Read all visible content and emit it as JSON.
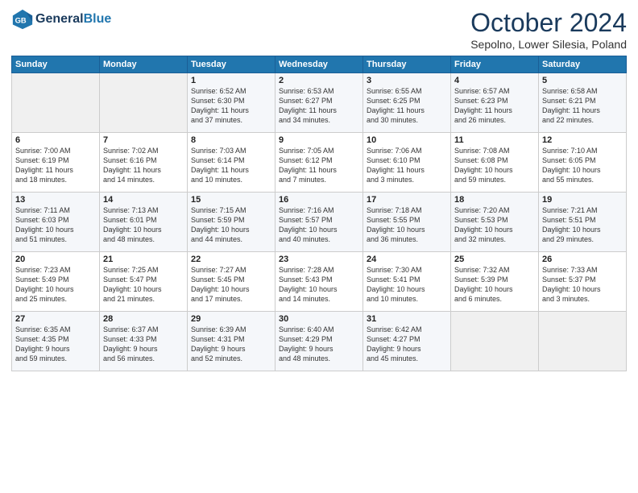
{
  "logo": {
    "line1": "General",
    "line2": "Blue"
  },
  "title": "October 2024",
  "subtitle": "Sepolno, Lower Silesia, Poland",
  "headers": [
    "Sunday",
    "Monday",
    "Tuesday",
    "Wednesday",
    "Thursday",
    "Friday",
    "Saturday"
  ],
  "weeks": [
    [
      {
        "day": "",
        "info": ""
      },
      {
        "day": "",
        "info": ""
      },
      {
        "day": "1",
        "info": "Sunrise: 6:52 AM\nSunset: 6:30 PM\nDaylight: 11 hours\nand 37 minutes."
      },
      {
        "day": "2",
        "info": "Sunrise: 6:53 AM\nSunset: 6:27 PM\nDaylight: 11 hours\nand 34 minutes."
      },
      {
        "day": "3",
        "info": "Sunrise: 6:55 AM\nSunset: 6:25 PM\nDaylight: 11 hours\nand 30 minutes."
      },
      {
        "day": "4",
        "info": "Sunrise: 6:57 AM\nSunset: 6:23 PM\nDaylight: 11 hours\nand 26 minutes."
      },
      {
        "day": "5",
        "info": "Sunrise: 6:58 AM\nSunset: 6:21 PM\nDaylight: 11 hours\nand 22 minutes."
      }
    ],
    [
      {
        "day": "6",
        "info": "Sunrise: 7:00 AM\nSunset: 6:19 PM\nDaylight: 11 hours\nand 18 minutes."
      },
      {
        "day": "7",
        "info": "Sunrise: 7:02 AM\nSunset: 6:16 PM\nDaylight: 11 hours\nand 14 minutes."
      },
      {
        "day": "8",
        "info": "Sunrise: 7:03 AM\nSunset: 6:14 PM\nDaylight: 11 hours\nand 10 minutes."
      },
      {
        "day": "9",
        "info": "Sunrise: 7:05 AM\nSunset: 6:12 PM\nDaylight: 11 hours\nand 7 minutes."
      },
      {
        "day": "10",
        "info": "Sunrise: 7:06 AM\nSunset: 6:10 PM\nDaylight: 11 hours\nand 3 minutes."
      },
      {
        "day": "11",
        "info": "Sunrise: 7:08 AM\nSunset: 6:08 PM\nDaylight: 10 hours\nand 59 minutes."
      },
      {
        "day": "12",
        "info": "Sunrise: 7:10 AM\nSunset: 6:05 PM\nDaylight: 10 hours\nand 55 minutes."
      }
    ],
    [
      {
        "day": "13",
        "info": "Sunrise: 7:11 AM\nSunset: 6:03 PM\nDaylight: 10 hours\nand 51 minutes."
      },
      {
        "day": "14",
        "info": "Sunrise: 7:13 AM\nSunset: 6:01 PM\nDaylight: 10 hours\nand 48 minutes."
      },
      {
        "day": "15",
        "info": "Sunrise: 7:15 AM\nSunset: 5:59 PM\nDaylight: 10 hours\nand 44 minutes."
      },
      {
        "day": "16",
        "info": "Sunrise: 7:16 AM\nSunset: 5:57 PM\nDaylight: 10 hours\nand 40 minutes."
      },
      {
        "day": "17",
        "info": "Sunrise: 7:18 AM\nSunset: 5:55 PM\nDaylight: 10 hours\nand 36 minutes."
      },
      {
        "day": "18",
        "info": "Sunrise: 7:20 AM\nSunset: 5:53 PM\nDaylight: 10 hours\nand 32 minutes."
      },
      {
        "day": "19",
        "info": "Sunrise: 7:21 AM\nSunset: 5:51 PM\nDaylight: 10 hours\nand 29 minutes."
      }
    ],
    [
      {
        "day": "20",
        "info": "Sunrise: 7:23 AM\nSunset: 5:49 PM\nDaylight: 10 hours\nand 25 minutes."
      },
      {
        "day": "21",
        "info": "Sunrise: 7:25 AM\nSunset: 5:47 PM\nDaylight: 10 hours\nand 21 minutes."
      },
      {
        "day": "22",
        "info": "Sunrise: 7:27 AM\nSunset: 5:45 PM\nDaylight: 10 hours\nand 17 minutes."
      },
      {
        "day": "23",
        "info": "Sunrise: 7:28 AM\nSunset: 5:43 PM\nDaylight: 10 hours\nand 14 minutes."
      },
      {
        "day": "24",
        "info": "Sunrise: 7:30 AM\nSunset: 5:41 PM\nDaylight: 10 hours\nand 10 minutes."
      },
      {
        "day": "25",
        "info": "Sunrise: 7:32 AM\nSunset: 5:39 PM\nDaylight: 10 hours\nand 6 minutes."
      },
      {
        "day": "26",
        "info": "Sunrise: 7:33 AM\nSunset: 5:37 PM\nDaylight: 10 hours\nand 3 minutes."
      }
    ],
    [
      {
        "day": "27",
        "info": "Sunrise: 6:35 AM\nSunset: 4:35 PM\nDaylight: 9 hours\nand 59 minutes."
      },
      {
        "day": "28",
        "info": "Sunrise: 6:37 AM\nSunset: 4:33 PM\nDaylight: 9 hours\nand 56 minutes."
      },
      {
        "day": "29",
        "info": "Sunrise: 6:39 AM\nSunset: 4:31 PM\nDaylight: 9 hours\nand 52 minutes."
      },
      {
        "day": "30",
        "info": "Sunrise: 6:40 AM\nSunset: 4:29 PM\nDaylight: 9 hours\nand 48 minutes."
      },
      {
        "day": "31",
        "info": "Sunrise: 6:42 AM\nSunset: 4:27 PM\nDaylight: 9 hours\nand 45 minutes."
      },
      {
        "day": "",
        "info": ""
      },
      {
        "day": "",
        "info": ""
      }
    ]
  ]
}
